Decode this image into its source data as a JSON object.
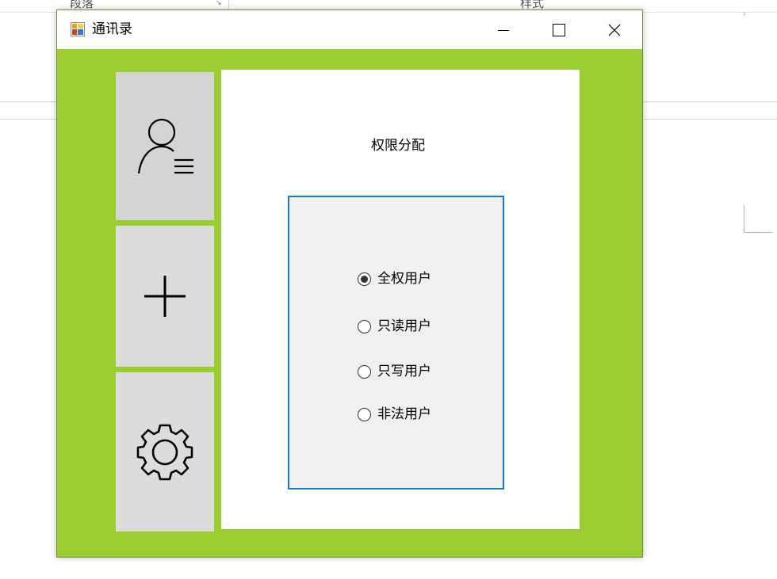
{
  "background": {
    "ribbon_left_label": "段落",
    "ribbon_right_label": "样式",
    "expander_glyph": "↘"
  },
  "window": {
    "title": "通讯录",
    "icon": "app-icon",
    "controls": {
      "minimize_icon": "minimize-icon",
      "maximize_icon": "maximize-icon",
      "close_icon": "close-icon"
    },
    "accent_color": "#9acd32"
  },
  "sidebar": {
    "items": [
      {
        "name": "user-list",
        "icon": "user-list-icon"
      },
      {
        "name": "add",
        "icon": "plus-icon"
      },
      {
        "name": "settings",
        "icon": "gear-icon"
      }
    ]
  },
  "main": {
    "title": "权限分配",
    "group_border_color": "#1679cf",
    "options": [
      {
        "label": "全权用户",
        "checked": true
      },
      {
        "label": "只读用户",
        "checked": false
      },
      {
        "label": "只写用户",
        "checked": false
      },
      {
        "label": "非法用户",
        "checked": false
      }
    ]
  }
}
